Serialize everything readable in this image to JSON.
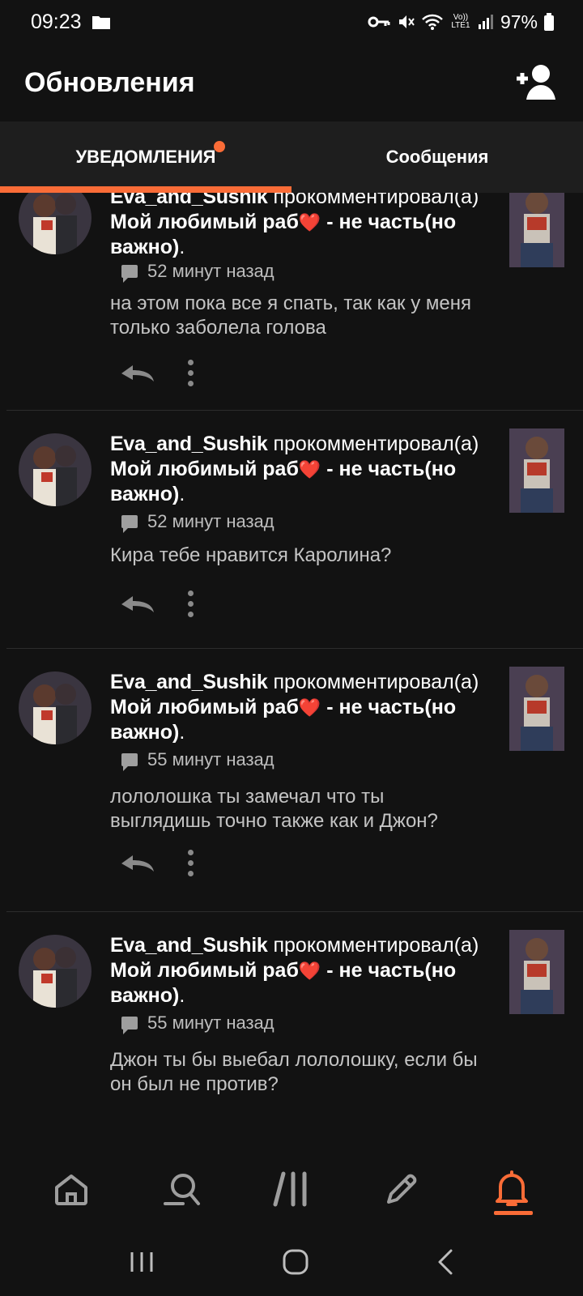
{
  "status_bar": {
    "time": "09:23",
    "battery": "97%",
    "network": "Vo)) LTE1"
  },
  "header": {
    "title": "Обновления",
    "add_user_icon": "add-user-icon"
  },
  "tabs": [
    {
      "label": "УВЕДОМЛЕНИЯ",
      "active": true,
      "has_dot": true
    },
    {
      "label": "Сообщения",
      "active": false,
      "has_dot": false
    }
  ],
  "colors": {
    "accent": "#fa6c37",
    "background": "#121212",
    "heart": "#e53935"
  },
  "notifications": [
    {
      "user": "Eva_and_Sushik",
      "verb": "прокомментировал(а)",
      "story": "Мой любимый раб",
      "story_suffix": " - не часть(но важно)",
      "time": "52 минут назад",
      "comment": "на этом пока все я спать, так как у меня только заболела голова"
    },
    {
      "user": "Eva_and_Sushik",
      "verb": "прокомментировал(а)",
      "story": "Мой любимый раб",
      "story_suffix": " - не часть(но важно)",
      "time": "52 минут назад",
      "comment": "Кира тебе нравится Каролина?"
    },
    {
      "user": "Eva_and_Sushik",
      "verb": "прокомментировал(а)",
      "story": "Мой любимый раб",
      "story_suffix": " - не часть(но важно)",
      "time": "55 минут назад",
      "comment": "лололошка ты замечал что ты выглядишь точно также как и Джон?"
    },
    {
      "user": "Eva_and_Sushik",
      "verb": "прокомментировал(а)",
      "story": "Мой любимый раб",
      "story_suffix": " - не часть(но важно)",
      "time": "55 минут назад",
      "comment": "Джон ты бы выебал лололошку, если бы он был не против?"
    }
  ],
  "bottom_nav": [
    {
      "name": "home-icon",
      "active": false
    },
    {
      "name": "search-icon",
      "active": false
    },
    {
      "name": "library-icon",
      "active": false
    },
    {
      "name": "write-icon",
      "active": false
    },
    {
      "name": "notifications-bell-icon",
      "active": true
    }
  ],
  "system_nav": [
    "recents-icon",
    "home-circle-icon",
    "back-icon"
  ]
}
